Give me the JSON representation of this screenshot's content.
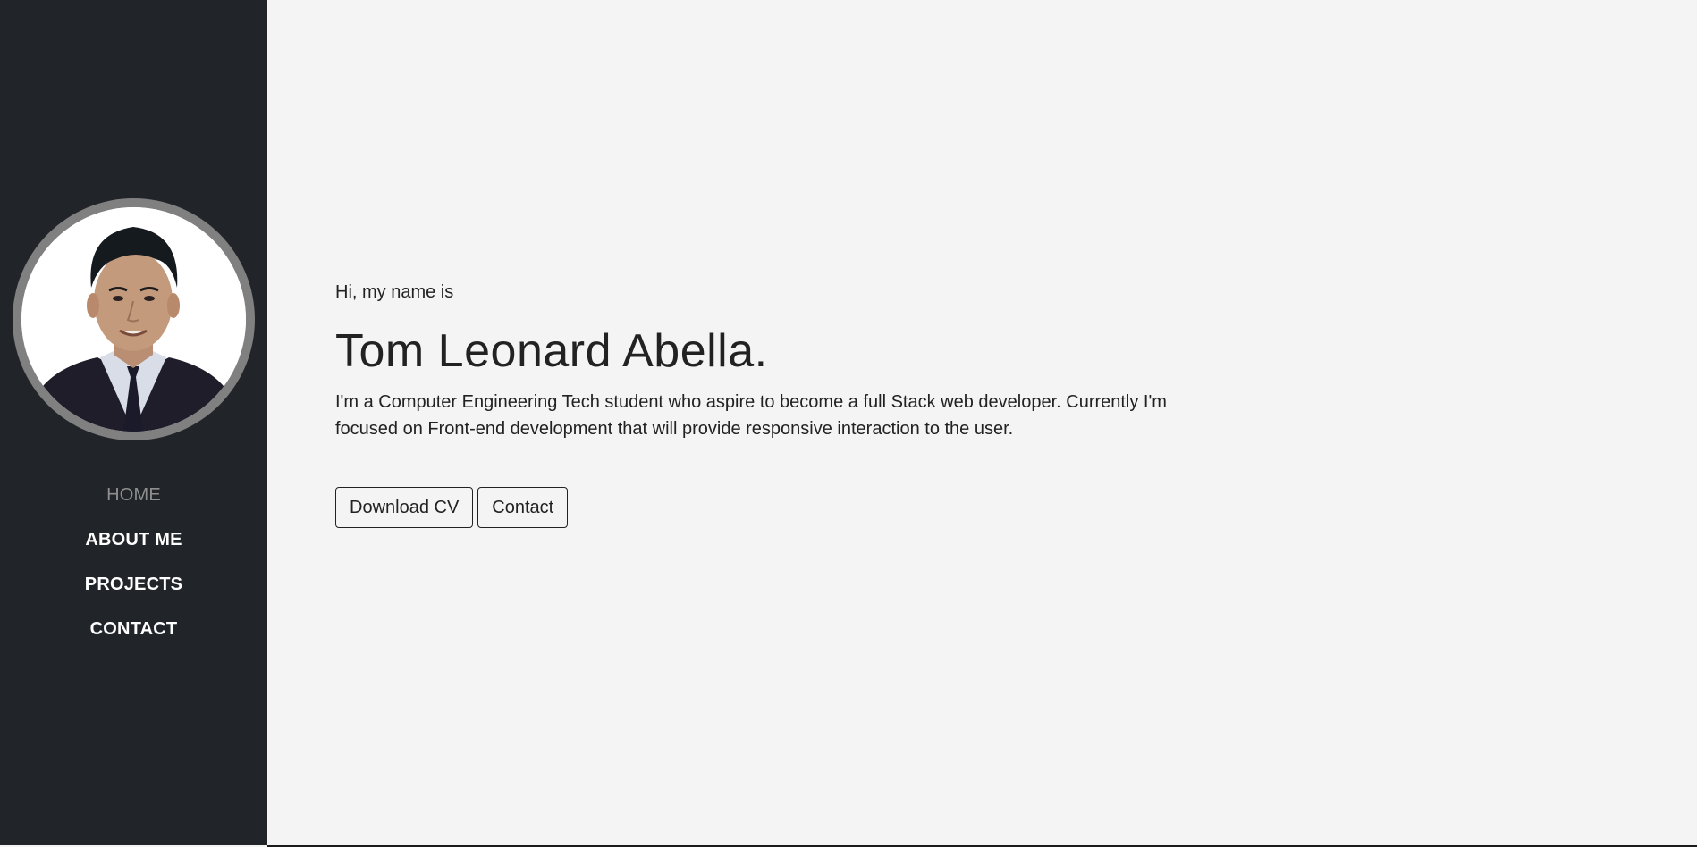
{
  "sidebar": {
    "avatar_alt": "Profile photo",
    "nav": [
      {
        "label": "HOME",
        "active": true
      },
      {
        "label": "ABOUT ME",
        "active": false
      },
      {
        "label": "PROJECTS",
        "active": false
      },
      {
        "label": "CONTACT",
        "active": false
      }
    ]
  },
  "hero": {
    "greeting": "Hi, my name is",
    "name": "Tom Leonard Abella.",
    "intro": "I'm a Computer Engineering Tech student who aspire to become a full Stack web developer. Currently I'm focused on Front-end development that will provide responsive interaction to the user.",
    "buttons": {
      "download_cv": "Download CV",
      "contact": "Contact"
    }
  },
  "colors": {
    "sidebar_bg": "#212529",
    "main_bg": "#f4f4f4",
    "nav_active": "#8f8f8f",
    "nav_text": "#ffffff",
    "avatar_ring": "#808080"
  }
}
